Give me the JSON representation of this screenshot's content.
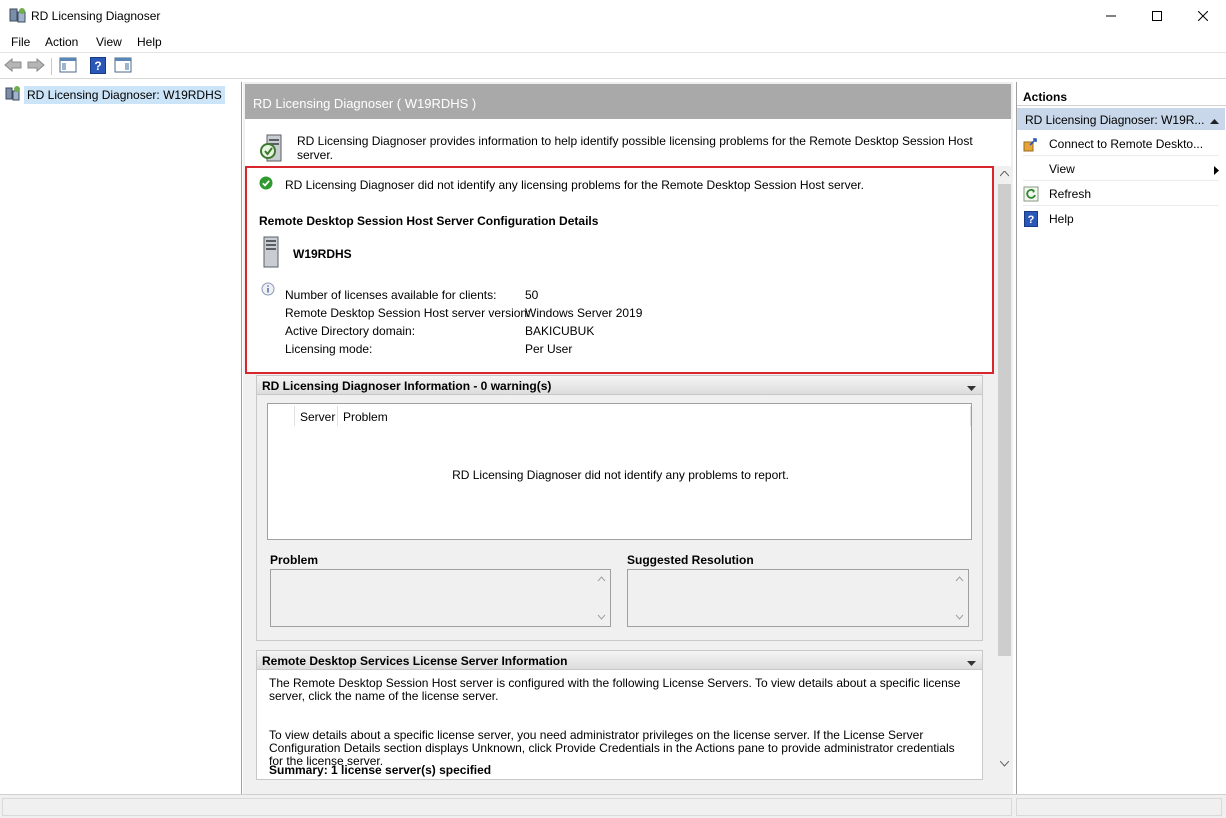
{
  "window": {
    "title": "RD Licensing Diagnoser",
    "icons": {
      "app": "rd-licensing-icon",
      "minimize": "minimize-icon",
      "maximize": "maximize-icon",
      "close": "close-icon"
    }
  },
  "menu": [
    "File",
    "Action",
    "View",
    "Help"
  ],
  "toolbar": {
    "icons": [
      "back-arrow-icon",
      "forward-arrow-icon",
      "show-hide-console-tree-icon",
      "help-icon",
      "show-hide-action-pane-icon"
    ]
  },
  "tree": {
    "root_label": "RD Licensing Diagnoser: W19RDHS"
  },
  "center": {
    "header": "RD Licensing Diagnoser ( W19RDHS )",
    "intro": "RD Licensing Diagnoser provides information to help identify possible licensing problems for the Remote Desktop Session Host server.",
    "status_message": "RD Licensing Diagnoser did not identify any licensing problems for the Remote Desktop Session Host server.",
    "config_title": "Remote Desktop Session Host Server Configuration Details",
    "server_name": "W19RDHS",
    "details": [
      {
        "key": "Number of licenses available for clients:",
        "value": "50"
      },
      {
        "key": "Remote Desktop Session Host server version:",
        "value": "Windows Server 2019"
      },
      {
        "key": "Active Directory domain:",
        "value": "BAKICUBUK"
      },
      {
        "key": "Licensing mode:",
        "value": "Per User"
      }
    ],
    "info_group": {
      "title": "RD Licensing Diagnoser Information - 0 warning(s)",
      "columns": [
        "Server",
        "Problem"
      ],
      "empty_message": "RD Licensing Diagnoser did not identify any problems to report.",
      "problem_label": "Problem",
      "resolution_label": "Suggested Resolution"
    },
    "license_group": {
      "title": "Remote Desktop Services License Server Information",
      "paragraph1": "The Remote Desktop Session Host server is configured with the following License Servers. To view details about a specific license server, click the name of the license server.",
      "paragraph2": "To view details about a specific license server, you need administrator privileges on the license server. If the License Server Configuration Details section displays Unknown, click Provide Credentials in the Actions pane to provide administrator credentials for the license server.",
      "summary": "Summary: 1 license server(s) specified"
    }
  },
  "actions": {
    "title": "Actions",
    "selected": "RD Licensing Diagnoser: W19R...",
    "items": [
      {
        "label": "Connect to Remote Deskto...",
        "icon": "connect-icon"
      },
      {
        "label": "View",
        "icon": "",
        "submenu": true
      },
      {
        "label": "Refresh",
        "icon": "refresh-icon"
      },
      {
        "label": "Help",
        "icon": "help-icon"
      }
    ]
  },
  "colors": {
    "accent_red": "#d9262c",
    "header_gray": "#a9a9a9",
    "selection_blue": "#cce4f7",
    "actions_selected": "#c9d7ea"
  }
}
